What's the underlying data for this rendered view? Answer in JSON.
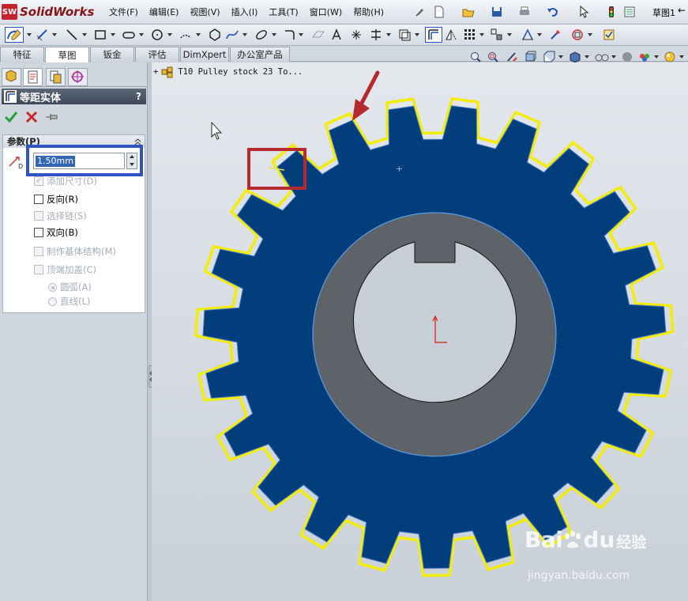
{
  "app": {
    "name": "SolidWorks",
    "doc_label": "草图1"
  },
  "menu": [
    "文件(F)",
    "编辑(E)",
    "视图(V)",
    "插入(I)",
    "工具(T)",
    "窗口(W)",
    "帮助(H)"
  ],
  "tabs": [
    "特征",
    "草图",
    "钣金",
    "评估",
    "DimXpert",
    "办公室产品"
  ],
  "active_tab": "草图",
  "tree": {
    "root": "T10 Pulley stock 23 To..."
  },
  "panel": {
    "title": "等距实体",
    "help": "?",
    "group_title": "参数(P)",
    "distance_value": "1.50mm",
    "options": [
      {
        "label": "添加尺寸(D)",
        "checked": true,
        "enabled": false
      },
      {
        "label": "反向(R)",
        "checked": false,
        "enabled": true
      },
      {
        "label": "选择链(S)",
        "checked": false,
        "enabled": false
      },
      {
        "label": "双向(B)",
        "checked": false,
        "enabled": true
      },
      {
        "label": "制作基体结构(M)",
        "checked": false,
        "enabled": false
      },
      {
        "label": "顶端加盖(C)",
        "checked": false,
        "enabled": false
      }
    ],
    "cap_options": [
      {
        "label": "圆弧(A)",
        "selected": true
      },
      {
        "label": "直线(L)",
        "selected": false
      }
    ]
  },
  "gear": {
    "teeth": 23,
    "fill": "#023d7c",
    "hub": "#5e6369",
    "bore": "#c8ced5",
    "offset": "#f2ec0c"
  },
  "watermark": {
    "brand": "Bai",
    "brand2": "du",
    "cn": "经验",
    "url": "jingyan.baidu.com"
  }
}
